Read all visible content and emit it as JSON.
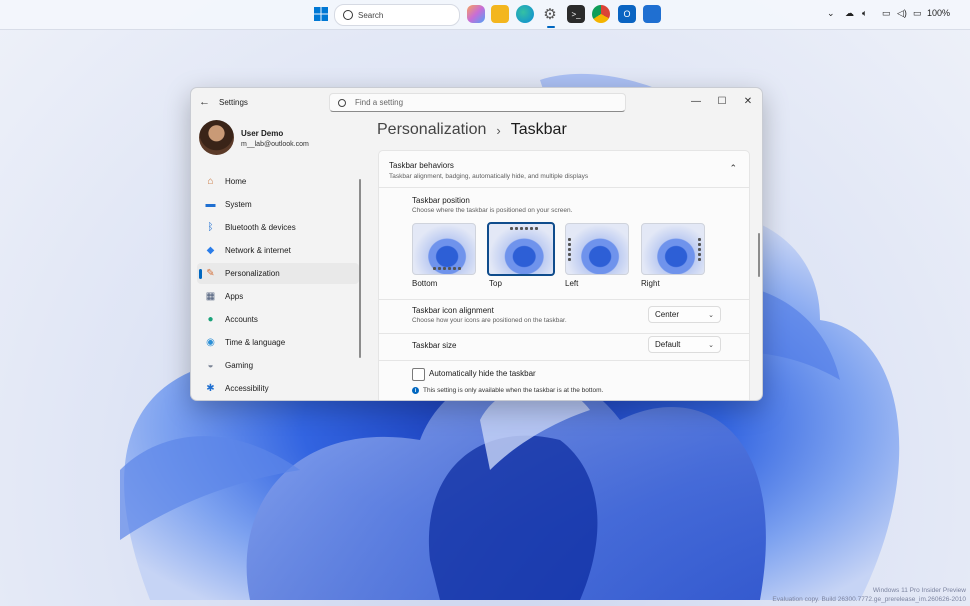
{
  "taskbar": {
    "search_placeholder": "Search",
    "battery": "100%",
    "colors": {
      "windows": "#0078d4",
      "files": "#f3b61f",
      "edge": "#0c8ad8",
      "terminal": "#2b2b2b",
      "chrome": "#db4437",
      "outlook": "#0a64c2",
      "store": "#1f6fd1"
    }
  },
  "window": {
    "app_title": "Settings",
    "search_placeholder": "Find a setting",
    "min_symbol": "—",
    "max_symbol": "☐",
    "close_symbol": "✕",
    "back_symbol": "←"
  },
  "user": {
    "name": "User Demo",
    "email": "m__lab@outlook.com"
  },
  "sidebar": {
    "items": [
      {
        "label": "Home",
        "icon": "home-icon",
        "glyph": "⌂",
        "color": "#c9753b"
      },
      {
        "label": "System",
        "icon": "monitor-icon",
        "glyph": "▬",
        "color": "#1f6fd1"
      },
      {
        "label": "Bluetooth & devices",
        "icon": "bluetooth-icon",
        "glyph": "ᛒ",
        "color": "#1f6fd1"
      },
      {
        "label": "Network & internet",
        "icon": "wifi-icon",
        "glyph": "◆",
        "color": "#2b7de9"
      },
      {
        "label": "Personalization",
        "icon": "brush-icon",
        "glyph": "✎",
        "color": "#d4703a"
      },
      {
        "label": "Apps",
        "icon": "apps-icon",
        "glyph": "▦",
        "color": "#4a5a78"
      },
      {
        "label": "Accounts",
        "icon": "person-icon",
        "glyph": "●",
        "color": "#1aa37a"
      },
      {
        "label": "Time & language",
        "icon": "globe-icon",
        "glyph": "◉",
        "color": "#2b8fd6"
      },
      {
        "label": "Gaming",
        "icon": "gamepad-icon",
        "glyph": "◒",
        "color": "#7c8596"
      },
      {
        "label": "Accessibility",
        "icon": "accessibility-icon",
        "glyph": "✱",
        "color": "#1f6fd1"
      }
    ],
    "selected_index": 4
  },
  "breadcrumb": {
    "parent": "Personalization",
    "separator": "›",
    "current": "Taskbar"
  },
  "behaviors": {
    "title": "Taskbar behaviors",
    "subtitle": "Taskbar alignment, badging, automatically hide, and multiple displays",
    "chevron": "⌃"
  },
  "position": {
    "title": "Taskbar position",
    "desc": "Choose where the taskbar is positioned on your screen.",
    "options": [
      "Bottom",
      "Top",
      "Left",
      "Right"
    ],
    "selected": "Top"
  },
  "alignment": {
    "title": "Taskbar icon alignment",
    "desc": "Choose how your icons are positioned on the taskbar.",
    "value": "Center"
  },
  "size": {
    "title": "Taskbar size",
    "value": "Default"
  },
  "autohide": {
    "label": "Automatically hide the taskbar",
    "checked": false,
    "note": "This setting is only available when the taskbar is at the bottom.",
    "info_glyph": "i"
  },
  "watermark": {
    "line1": "Windows 11 Pro Insider Preview",
    "line2": "Evaluation copy. Build 26300.7772.ge_prerelease_im.260626-2010"
  }
}
